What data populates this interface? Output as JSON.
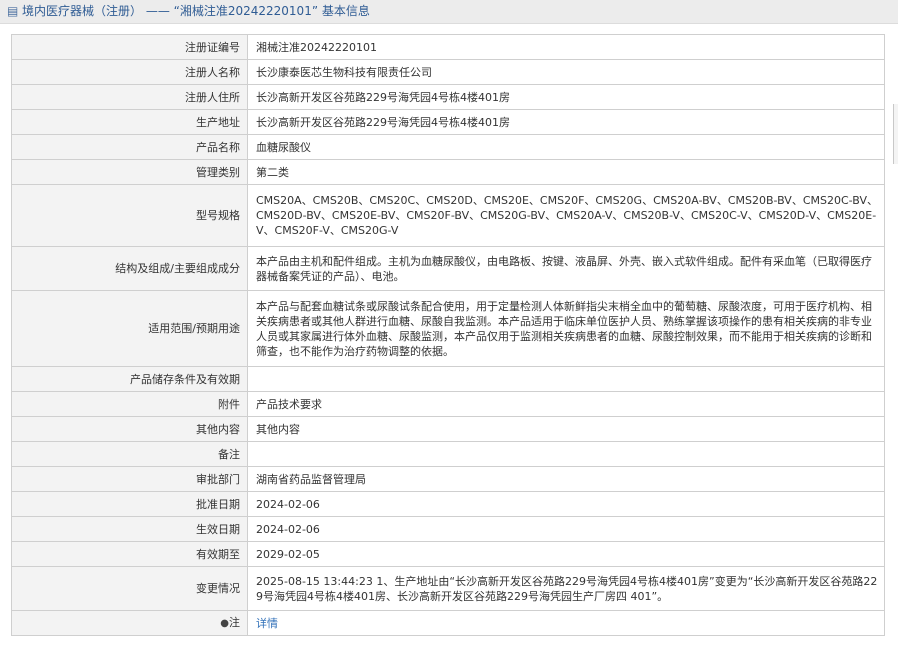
{
  "header": {
    "title": "境内医疗器械（注册） —— “湘械注准20242220101” 基本信息"
  },
  "rows": [
    {
      "label": "注册证编号",
      "value": "湘械注准20242220101"
    },
    {
      "label": "注册人名称",
      "value": "长沙康泰医芯生物科技有限责任公司"
    },
    {
      "label": "注册人住所",
      "value": "长沙高新开发区谷苑路229号海凭园4号栋4楼401房"
    },
    {
      "label": "生产地址",
      "value": "长沙高新开发区谷苑路229号海凭园4号栋4楼401房"
    },
    {
      "label": "产品名称",
      "value": "血糖尿酸仪"
    },
    {
      "label": "管理类别",
      "value": "第二类"
    },
    {
      "label": "型号规格",
      "value": "CMS20A、CMS20B、CMS20C、CMS20D、CMS20E、CMS20F、CMS20G、CMS20A-BV、CMS20B-BV、CMS20C-BV、CMS20D-BV、CMS20E-BV、CMS20F-BV、CMS20G-BV、CMS20A-V、CMS20B-V、CMS20C-V、CMS20D-V、CMS20E-V、CMS20F-V、CMS20G-V"
    },
    {
      "label": "结构及组成/主要组成成分",
      "value": "本产品由主机和配件组成。主机为血糖尿酸仪，由电路板、按键、液晶屏、外壳、嵌入式软件组成。配件有采血笔（已取得医疗器械备案凭证的产品）、电池。"
    },
    {
      "label": "适用范围/预期用途",
      "value": "本产品与配套血糖试条或尿酸试条配合使用，用于定量检测人体新鲜指尖末梢全血中的葡萄糖、尿酸浓度，可用于医疗机构、相关疾病患者或其他人群进行血糖、尿酸自我监测。本产品适用于临床单位医护人员、熟练掌握该项操作的患有相关疾病的非专业人员或其家属进行体外血糖、尿酸监测，本产品仅用于监测相关疾病患者的血糖、尿酸控制效果，而不能用于相关疾病的诊断和筛查，也不能作为治疗药物调整的依据。"
    },
    {
      "label": "产品储存条件及有效期",
      "value": ""
    },
    {
      "label": "附件",
      "value": "产品技术要求"
    },
    {
      "label": "其他内容",
      "value": "其他内容"
    },
    {
      "label": "备注",
      "value": ""
    },
    {
      "label": "审批部门",
      "value": "湖南省药品监督管理局"
    },
    {
      "label": "批准日期",
      "value": "2024-02-06"
    },
    {
      "label": "生效日期",
      "value": "2024-02-06"
    },
    {
      "label": "有效期至",
      "value": "2029-02-05"
    },
    {
      "label": "变更情况",
      "value": "2025-08-15 13:44:23 1、生产地址由“长沙高新开发区谷苑路229号海凭园4号栋4楼401房”变更为“长沙高新开发区谷苑路229号海凭园4号栋4楼401房、长沙高新开发区谷苑路229号海凭园生产厂房四 401”。"
    }
  ],
  "note_row": {
    "label": "注",
    "link_text": "详情"
  }
}
